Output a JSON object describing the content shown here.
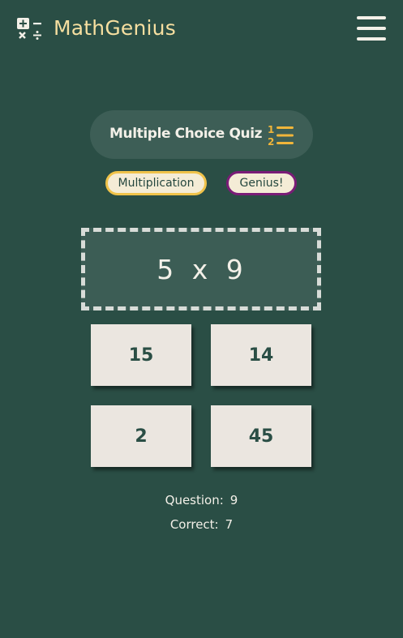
{
  "app": {
    "brand_name": "MathGenius",
    "logo_icon": "math-operators-icon",
    "menu_icon": "hamburger-menu-icon"
  },
  "colors": {
    "background": "#2a4e45",
    "brand_text": "#f6dfa0",
    "operation_tag_border": "#f0c34a",
    "level_tag_border": "#7a1c77",
    "answer_button_bg": "#ebe6e0"
  },
  "quiz": {
    "title": "Multiple Choice Quiz",
    "title_icon": "numbered-list-icon",
    "operation": "Multiplication",
    "level": "Genius!"
  },
  "question": {
    "text": "5 x 9"
  },
  "answers": [
    {
      "label": "15"
    },
    {
      "label": "14"
    },
    {
      "label": "2"
    },
    {
      "label": "45"
    }
  ],
  "stats": {
    "question_label": "Question:",
    "question_value": "9",
    "correct_label": "Correct:",
    "correct_value": "7"
  }
}
